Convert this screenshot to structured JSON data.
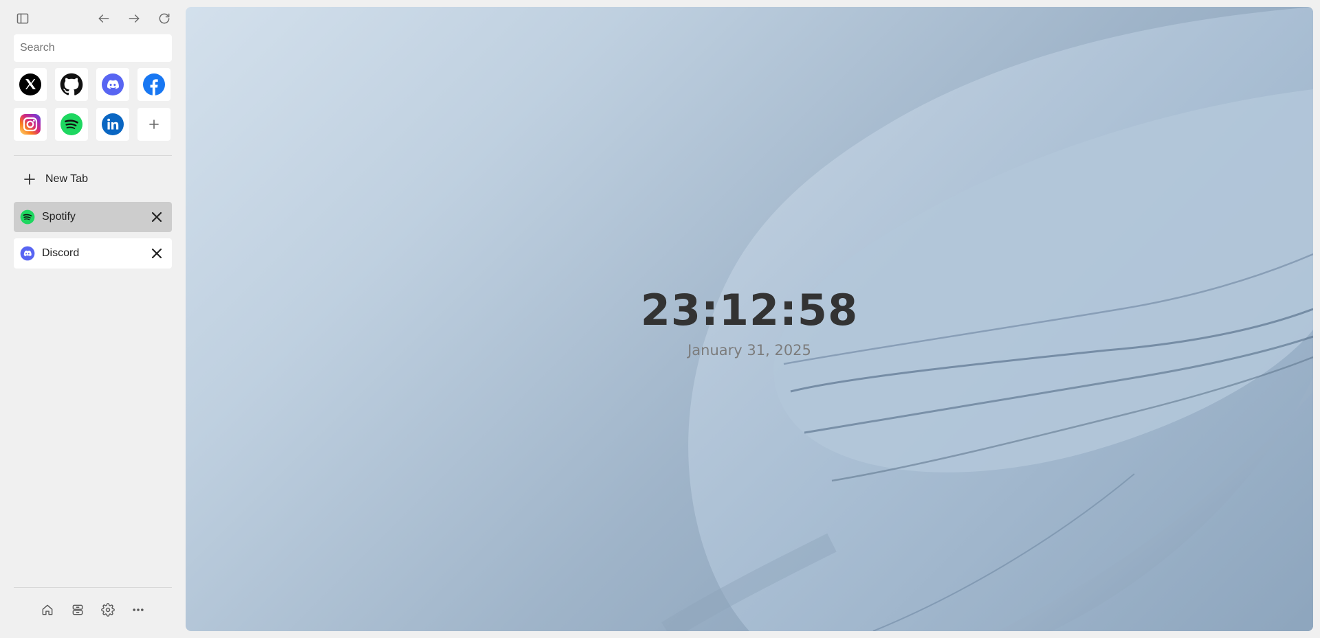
{
  "toolbar": {
    "sidebar_toggle_icon": "sidebar-panel-icon",
    "back_icon": "arrow-left-icon",
    "forward_icon": "arrow-right-icon",
    "reload_icon": "reload-icon"
  },
  "search": {
    "placeholder": "Search",
    "value": ""
  },
  "shortcuts": [
    {
      "name": "X",
      "icon": "x-logo-icon",
      "color": "#000000"
    },
    {
      "name": "GitHub",
      "icon": "github-logo-icon",
      "color": "#111111"
    },
    {
      "name": "Discord",
      "icon": "discord-logo-icon",
      "color": "#5865F2"
    },
    {
      "name": "Facebook",
      "icon": "facebook-logo-icon",
      "color": "#1877F2"
    },
    {
      "name": "Instagram",
      "icon": "instagram-logo-icon",
      "color": "#E1306C"
    },
    {
      "name": "Spotify",
      "icon": "spotify-logo-icon",
      "color": "#1ED760"
    },
    {
      "name": "LinkedIn",
      "icon": "linkedin-logo-icon",
      "color": "#0A66C2"
    },
    {
      "name": "Add shortcut",
      "icon": "plus-icon",
      "color": "#555555"
    }
  ],
  "new_tab": {
    "label": "New Tab"
  },
  "tabs": [
    {
      "title": "Spotify",
      "icon": "spotify-logo-icon",
      "active": true
    },
    {
      "title": "Discord",
      "icon": "discord-logo-icon",
      "active": false
    }
  ],
  "bottom_bar": {
    "icons": [
      "home-icon",
      "storage-icon",
      "gear-icon",
      "more-icon"
    ]
  },
  "main": {
    "time": "23:12:58",
    "date": "January 31, 2025"
  }
}
